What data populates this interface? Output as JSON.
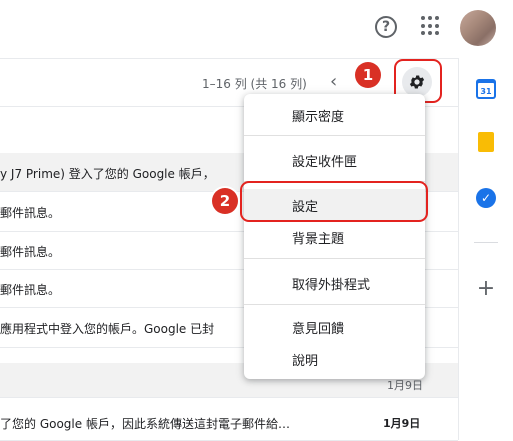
{
  "header": {
    "help_icon": "help-circle-icon",
    "help_glyph": "?",
    "apps_icon": "apps-grid-icon",
    "avatar_icon": "account-avatar"
  },
  "toolbar": {
    "pagination": "1–16 列 (共 16 列)",
    "prev_glyph": "‹",
    "settings_icon": "gear-icon"
  },
  "annotations": {
    "step1": "1",
    "step2": "2",
    "highlight_color": "#e3231f"
  },
  "email_rows": [
    {
      "snippet": "y J7 Prime) 登入了您的 Google 帳戶，"
    },
    {
      "snippet": "郵件訊息。"
    },
    {
      "snippet": "郵件訊息。"
    },
    {
      "snippet": "郵件訊息。"
    },
    {
      "snippet": "應用程式中登入您的帳戶。Google 已封"
    },
    {
      "snippet": "",
      "date": "1月9日"
    },
    {
      "snippet": "了您的 Google 帳戶，因此系統傳送這封電子郵件給…",
      "date": "1月9日"
    }
  ],
  "settings_menu": {
    "items": [
      {
        "label": "顯示密度"
      },
      {
        "label": "設定收件匣"
      },
      {
        "label": "設定"
      },
      {
        "label": "背景主題"
      },
      {
        "label": "取得外掛程式"
      },
      {
        "label": "意見回饋"
      },
      {
        "label": "說明"
      }
    ]
  },
  "side_panel": {
    "calendar_icon": "calendar-icon",
    "calendar_label": "31",
    "keep_icon": "keep-icon",
    "tasks_icon": "tasks-icon",
    "tasks_glyph": "✓",
    "add_glyph": "+"
  }
}
